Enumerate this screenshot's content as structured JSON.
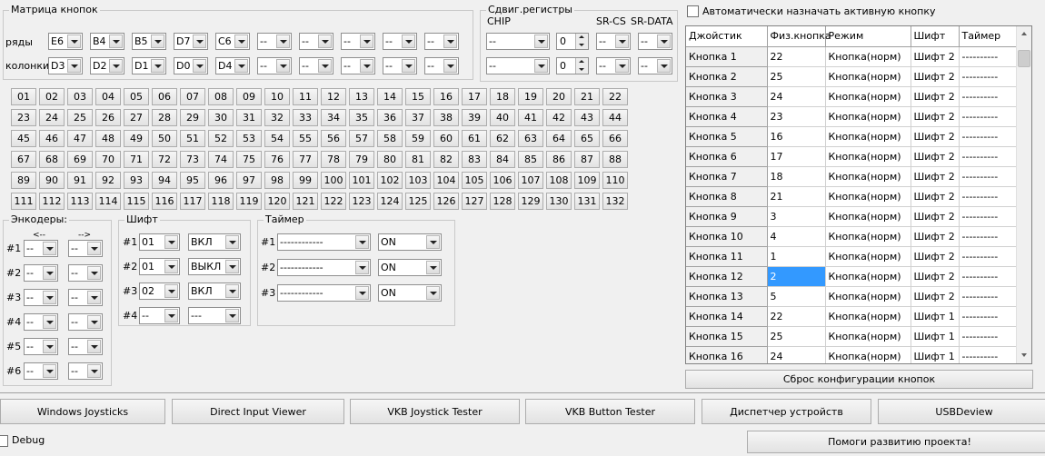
{
  "matrix": {
    "title": "Матрица кнопок",
    "rows_label": "ряды",
    "cols_label": "колонки",
    "rows": [
      "E6",
      "B4",
      "B5",
      "D7",
      "C6",
      "--",
      "--",
      "--",
      "--",
      "--"
    ],
    "cols": [
      "D3",
      "D2",
      "D1",
      "D0",
      "D4",
      "--",
      "--",
      "--",
      "--",
      "--"
    ],
    "buttons": [
      "01",
      "02",
      "03",
      "04",
      "05",
      "06",
      "07",
      "08",
      "09",
      "10",
      "11",
      "12",
      "13",
      "14",
      "15",
      "16",
      "17",
      "18",
      "19",
      "20",
      "21",
      "22",
      "23",
      "24",
      "25",
      "26",
      "27",
      "28",
      "29",
      "30",
      "31",
      "32",
      "33",
      "34",
      "35",
      "36",
      "37",
      "38",
      "39",
      "40",
      "41",
      "42",
      "43",
      "44",
      "45",
      "46",
      "47",
      "48",
      "49",
      "50",
      "51",
      "52",
      "53",
      "54",
      "55",
      "56",
      "57",
      "58",
      "59",
      "60",
      "61",
      "62",
      "63",
      "64",
      "65",
      "66",
      "67",
      "68",
      "69",
      "70",
      "71",
      "72",
      "73",
      "74",
      "75",
      "76",
      "77",
      "78",
      "79",
      "80",
      "81",
      "82",
      "83",
      "84",
      "85",
      "86",
      "87",
      "88",
      "89",
      "90",
      "91",
      "92",
      "93",
      "94",
      "95",
      "96",
      "97",
      "98",
      "99",
      "100",
      "101",
      "102",
      "103",
      "104",
      "105",
      "106",
      "107",
      "108",
      "109",
      "110",
      "111",
      "112",
      "113",
      "114",
      "115",
      "116",
      "117",
      "118",
      "119",
      "120",
      "121",
      "122",
      "123",
      "124",
      "125",
      "126",
      "127",
      "128",
      "129",
      "130",
      "131",
      "132"
    ]
  },
  "shift_registers": {
    "title": "Сдвиг.регистры",
    "chip_label": "CHIP",
    "srcs_label": "SR-CS",
    "srdata_label": "SR-DATA",
    "rows": [
      {
        "chip": "--",
        "count": "0",
        "cs": "--",
        "data": "--"
      },
      {
        "chip": "--",
        "count": "0",
        "cs": "--",
        "data": "--"
      }
    ]
  },
  "encoders": {
    "title": "Энкодеры:",
    "left_arrow": "<--",
    "right_arrow": "-->",
    "rows": [
      {
        "label": "#1",
        "a": "--",
        "b": "--"
      },
      {
        "label": "#2",
        "a": "--",
        "b": "--"
      },
      {
        "label": "#3",
        "a": "--",
        "b": "--"
      },
      {
        "label": "#4",
        "a": "--",
        "b": "--"
      },
      {
        "label": "#5",
        "a": "--",
        "b": "--"
      },
      {
        "label": "#6",
        "a": "--",
        "b": "--"
      }
    ]
  },
  "shift": {
    "title": "Шифт",
    "rows": [
      {
        "label": "#1",
        "button": "01",
        "mode": "ВКЛ"
      },
      {
        "label": "#2",
        "button": "01",
        "mode": "ВЫКЛ"
      },
      {
        "label": "#3",
        "button": "02",
        "mode": "ВКЛ"
      },
      {
        "label": "#4",
        "button": "--",
        "mode": "---"
      }
    ]
  },
  "timer": {
    "title": "Таймер",
    "rows": [
      {
        "label": "#1",
        "value": "------------",
        "state": "ON"
      },
      {
        "label": "#2",
        "value": "------------",
        "state": "ON"
      },
      {
        "label": "#3",
        "value": "------------",
        "state": "ON"
      }
    ]
  },
  "auto_assign": {
    "label": "Автоматически назначать активную кнопку",
    "checked": false
  },
  "grid": {
    "headers": [
      "Джойстик",
      "Физ.кнопка",
      "Режим",
      "Шифт",
      "Таймер"
    ],
    "rows": [
      {
        "name": "Кнопка 1",
        "phys": "22",
        "mode": "Кнопка(норм)",
        "shift": "Шифт 2",
        "timer": "----------"
      },
      {
        "name": "Кнопка 2",
        "phys": "25",
        "mode": "Кнопка(норм)",
        "shift": "Шифт 2",
        "timer": "----------"
      },
      {
        "name": "Кнопка 3",
        "phys": "24",
        "mode": "Кнопка(норм)",
        "shift": "Шифт 2",
        "timer": "----------"
      },
      {
        "name": "Кнопка 4",
        "phys": "23",
        "mode": "Кнопка(норм)",
        "shift": "Шифт 2",
        "timer": "----------"
      },
      {
        "name": "Кнопка 5",
        "phys": "16",
        "mode": "Кнопка(норм)",
        "shift": "Шифт 2",
        "timer": "----------"
      },
      {
        "name": "Кнопка 6",
        "phys": "17",
        "mode": "Кнопка(норм)",
        "shift": "Шифт 2",
        "timer": "----------"
      },
      {
        "name": "Кнопка 7",
        "phys": "18",
        "mode": "Кнопка(норм)",
        "shift": "Шифт 2",
        "timer": "----------"
      },
      {
        "name": "Кнопка 8",
        "phys": "21",
        "mode": "Кнопка(норм)",
        "shift": "Шифт 2",
        "timer": "----------"
      },
      {
        "name": "Кнопка 9",
        "phys": "3",
        "mode": "Кнопка(норм)",
        "shift": "Шифт 2",
        "timer": "----------"
      },
      {
        "name": "Кнопка 10",
        "phys": "4",
        "mode": "Кнопка(норм)",
        "shift": "Шифт 2",
        "timer": "----------"
      },
      {
        "name": "Кнопка 11",
        "phys": "1",
        "mode": "Кнопка(норм)",
        "shift": "Шифт 2",
        "timer": "----------"
      },
      {
        "name": "Кнопка 12",
        "phys": "2",
        "mode": "Кнопка(норм)",
        "shift": "Шифт 2",
        "timer": "----------"
      },
      {
        "name": "Кнопка 13",
        "phys": "5",
        "mode": "Кнопка(норм)",
        "shift": "Шифт 2",
        "timer": "----------"
      },
      {
        "name": "Кнопка 14",
        "phys": "22",
        "mode": "Кнопка(норм)",
        "shift": "Шифт 1",
        "timer": "----------"
      },
      {
        "name": "Кнопка 15",
        "phys": "25",
        "mode": "Кнопка(норм)",
        "shift": "Шифт 1",
        "timer": "----------"
      },
      {
        "name": "Кнопка 16",
        "phys": "24",
        "mode": "Кнопка(норм)",
        "shift": "Шифт 1",
        "timer": "----------"
      }
    ],
    "selected_row": 11,
    "selection_color": "#3399ff"
  },
  "reset_button": "Сброс конфигурации кнопок",
  "toolbar": {
    "buttons": [
      "Windows Joysticks",
      "Direct Input Viewer",
      "VKB Joystick Tester",
      "VKB Button Tester",
      "Диспетчер устройств",
      "USBDeview"
    ]
  },
  "debug": {
    "label": "Debug",
    "checked": false
  },
  "help_button": "Помоги развитию проекта!"
}
